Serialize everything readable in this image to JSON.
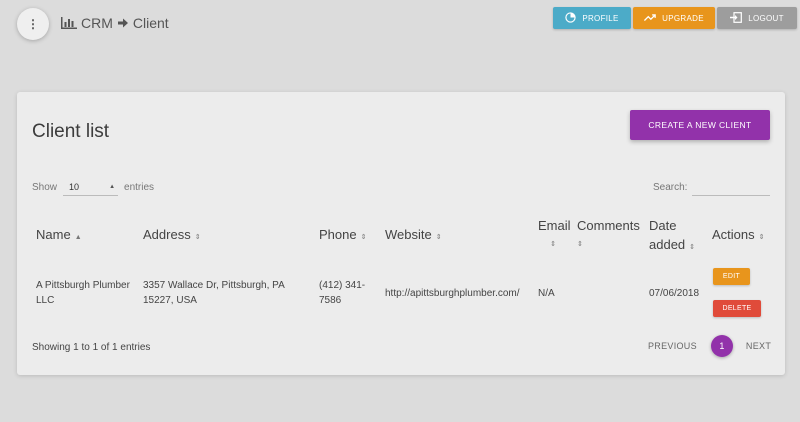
{
  "header": {
    "menu_icon": "more-vert-icon",
    "breadcrumb": {
      "root": "CRM",
      "current": "Client"
    },
    "buttons": {
      "profile": "PROFILE",
      "upgrade": "UPGRADE",
      "logout": "LOGOUT"
    },
    "colors": {
      "profile": "#4cabc8",
      "upgrade": "#e8951c",
      "logout": "#9d9d9d"
    }
  },
  "card": {
    "title": "Client list",
    "create_button": "CREATE A NEW CLIENT",
    "accent": "#9232aa"
  },
  "table_controls": {
    "show_label": "Show",
    "entries_value": "10",
    "entries_label": "entries",
    "search_label": "Search:",
    "search_value": ""
  },
  "table": {
    "columns": [
      {
        "label": "Name",
        "sort": "asc"
      },
      {
        "label": "Address",
        "sort": "both"
      },
      {
        "label": "Phone",
        "sort": "both"
      },
      {
        "label": "Website",
        "sort": "both"
      },
      {
        "label": "Email",
        "sort": "both"
      },
      {
        "label": "Comments",
        "sort": "both"
      },
      {
        "label_line1": "Date",
        "label_line2": "added",
        "sort": "both"
      },
      {
        "label": "Actions",
        "sort": "both"
      }
    ],
    "rows": [
      {
        "name_line1": "A Pittsburgh Plumber",
        "name_line2": "LLC",
        "address_line1": "3357 Wallace Dr, Pittsburgh, PA",
        "address_line2": "15227, USA",
        "phone_line1": "(412) 341-",
        "phone_line2": "7586",
        "website": "http://apittsburghplumber.com/",
        "email": "N/A",
        "comments": "",
        "date_added": "07/06/2018",
        "edit_label": "EDIT",
        "delete_label": "DELETE"
      }
    ]
  },
  "footer": {
    "info": "Showing 1 to 1 of 1 entries",
    "previous": "PREVIOUS",
    "current_page": "1",
    "next": "NEXT"
  },
  "action_colors": {
    "edit": "#e8951c",
    "delete": "#e04b3a"
  }
}
